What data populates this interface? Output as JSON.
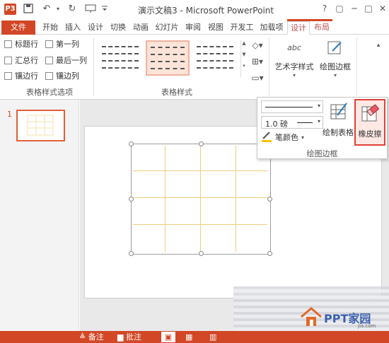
{
  "titlebar": {
    "app_badge": "P3",
    "title": "演示文稿3 - Microsoft PowerPoint",
    "window_buttons": [
      "?",
      "▢",
      "─",
      "□",
      "✕"
    ]
  },
  "tabs": {
    "file": "文件",
    "items": [
      "开始",
      "插入",
      "设计",
      "切换",
      "动画",
      "幻灯片",
      "审阅",
      "视图",
      "开发工",
      "加载项"
    ],
    "context_items": [
      "设计",
      "布局"
    ],
    "active": "设计"
  },
  "table_style_options": {
    "group_label": "表格样式选项",
    "checks": [
      {
        "label": "标题行",
        "checked": false
      },
      {
        "label": "第一列",
        "checked": false
      },
      {
        "label": "汇总行",
        "checked": false
      },
      {
        "label": "最后一列",
        "checked": false
      },
      {
        "label": "镶边行",
        "checked": false
      },
      {
        "label": "镶边列",
        "checked": false
      }
    ]
  },
  "table_styles": {
    "group_label": "表格样式",
    "selected_index": 1
  },
  "wordart": {
    "icon_text": "abc",
    "label": "艺术字样式"
  },
  "draw_border": {
    "label": "绘图边框",
    "pen_weight": "1.0 磅",
    "pen_color_label": "笔颜色",
    "draw_table_label": "绘制表格",
    "eraser_label": "橡皮擦",
    "group_label": "绘图边框"
  },
  "slide_pane": {
    "slide_number": "1"
  },
  "statusbar": {
    "notes": "备注",
    "comments": "批注"
  },
  "watermark": {
    "text": "PPT家园",
    "url": "jia.com"
  },
  "colors": {
    "accent": "#d24726",
    "eraser_highlight": "#e0403a",
    "table_grid": "#f0cd7e"
  }
}
